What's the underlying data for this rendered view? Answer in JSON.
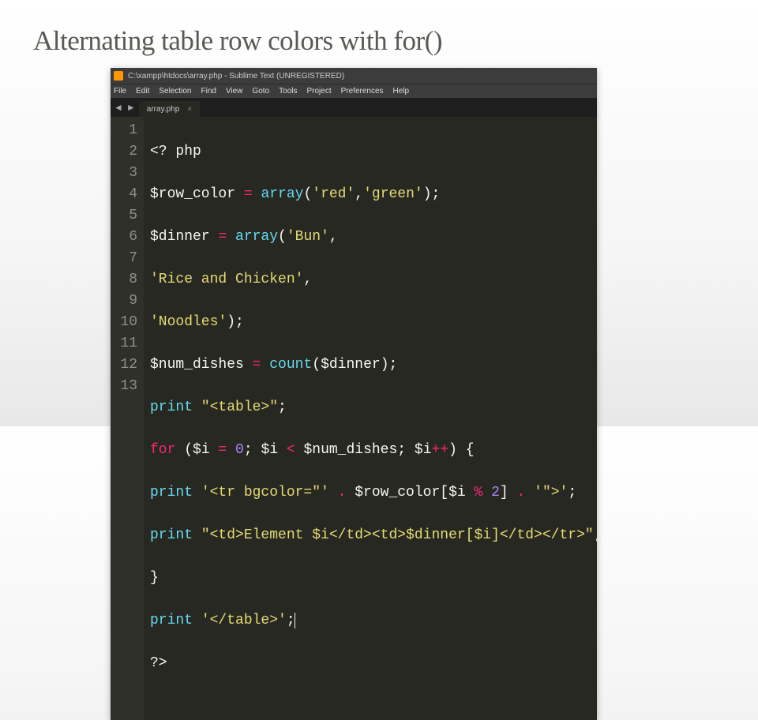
{
  "slide": {
    "title": "Alternating table row colors with for()"
  },
  "window": {
    "title": "C:\\xampp\\htdocs\\array.php - Sublime Text (UNREGISTERED)",
    "tab_label": "array.php"
  },
  "menu": {
    "items": [
      "File",
      "Edit",
      "Selection",
      "Find",
      "View",
      "Goto",
      "Tools",
      "Project",
      "Preferences",
      "Help"
    ]
  },
  "gutter": {
    "lines": [
      "1",
      "2",
      "3",
      "4",
      "5",
      "6",
      "7",
      "8",
      "9",
      "10",
      "11",
      "12",
      "13"
    ]
  },
  "code": {
    "l1": {
      "open": "<? php"
    },
    "l2": {
      "var": "$row_color",
      "eq": " = ",
      "fn": "array",
      "s1": "'red'",
      "comma": ",",
      "s2": "'green'",
      "end": ");"
    },
    "l3": {
      "var": "$dinner",
      "eq": " = ",
      "fn": "array",
      "s1": "'Bun'",
      "comma": ","
    },
    "l4": {
      "s": "'Rice and Chicken'",
      "comma": ","
    },
    "l5": {
      "s": "'Noodles'",
      "end": ");"
    },
    "l6": {
      "var": "$num_dishes",
      "eq": " = ",
      "fn": "count",
      "arg": "$dinner",
      "end": ");"
    },
    "l7": {
      "kw": "print ",
      "s": "\"<table>\"",
      "end": ";"
    },
    "l8": {
      "kw": "for",
      "open": " (",
      "v1": "$i",
      "eq": " = ",
      "n0": "0",
      "semi1": "; ",
      "v2": "$i",
      "lt": " < ",
      "v3": "$num_dishes",
      "semi2": "; ",
      "v4": "$i",
      "inc": "++",
      "close": ") {"
    },
    "l9": {
      "kw": "print ",
      "s1": "'<tr bgcolor=\"'",
      "dot1": " . ",
      "v1": "$row_color",
      "lb": "[",
      "v2": "$i",
      "mod": " % ",
      "n2": "2",
      "rb": "]",
      "dot2": " . ",
      "s2": "'\">'",
      "end": ";"
    },
    "l10": {
      "kw": "print ",
      "s": "\"<td>Element $i</td><td>$dinner[$i]</td></tr>\"",
      "end": ";"
    },
    "l11": {
      "brace": "}"
    },
    "l12": {
      "kw": "print ",
      "s": "'</table>'",
      "end": ";"
    },
    "l13": {
      "close": "?>"
    }
  }
}
